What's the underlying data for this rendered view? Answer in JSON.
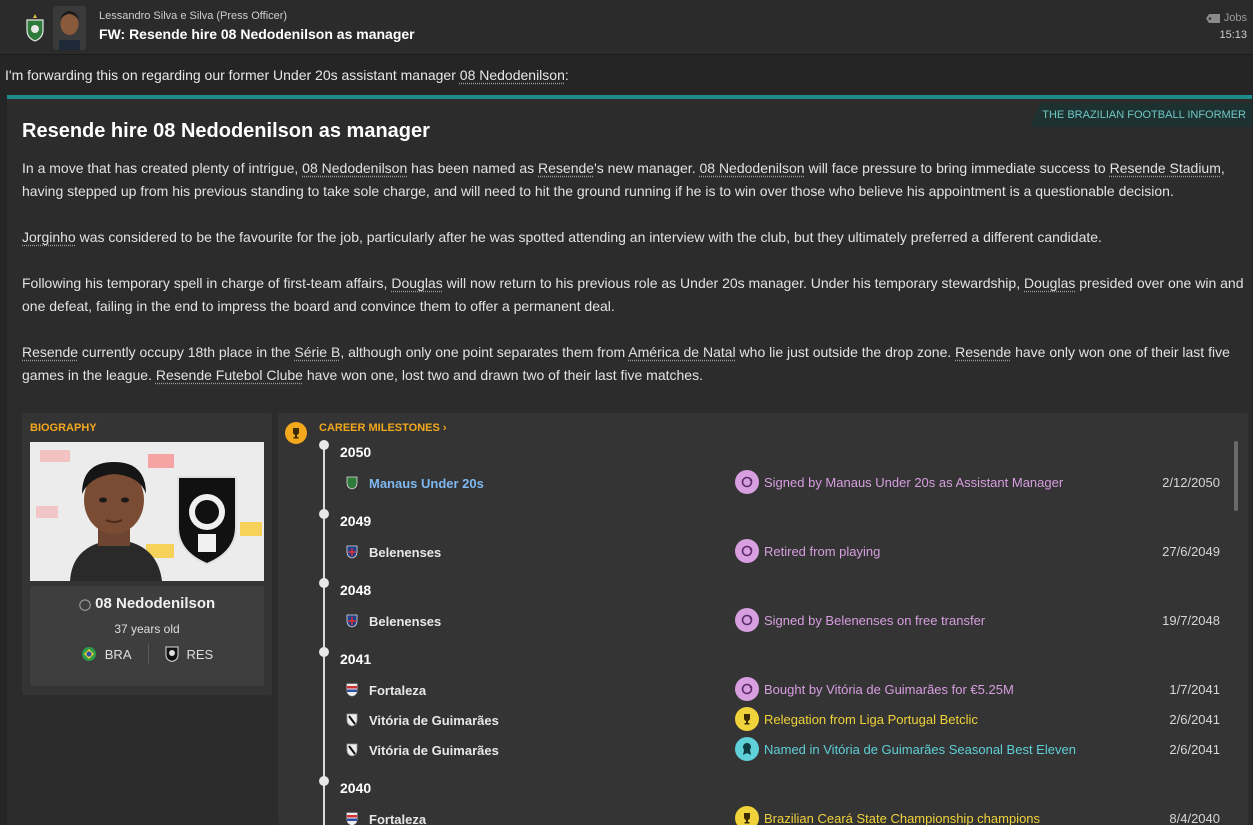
{
  "header": {
    "sender": "Lessandro Silva e Silva  (Press Officer)",
    "subject": "FW: Resende hire 08 Nedodenilson as manager",
    "tag": "Jobs",
    "time": "15:13"
  },
  "intro": {
    "text_before": "I'm forwarding this on regarding our former Under 20s assistant manager ",
    "person": "08 Nedodenilson",
    "text_after": ":"
  },
  "article": {
    "source": "THE BRAZILIAN FOOTBALL INFORMER",
    "title": "Resende hire 08 Nedodenilson as manager",
    "p1": [
      "In a move that has created plenty of intrigue, ",
      "08 Nedodenilson",
      " has been named as ",
      "Resende",
      "'s new manager. ",
      "08 Nedodenilson",
      " will face pressure to bring immediate success to ",
      "Resende Stadium",
      ", having stepped up from his previous standing to take sole charge, and will need to hit the ground running if he is to win over those who believe his appointment is a questionable decision."
    ],
    "p2": [
      "Jorginho",
      " was considered to be the favourite for the job, particularly after he was spotted attending an interview with the club, but they ultimately preferred a different candidate."
    ],
    "p3": [
      "Following his temporary spell in charge of first-team affairs, ",
      "Douglas",
      " will now return to his previous role as Under 20s manager. Under his temporary stewardship, ",
      "Douglas",
      " presided over one win and one defeat, failing in the end to impress the board and convince them to offer a permanent deal."
    ],
    "p4": [
      "Resende",
      " currently occupy 18th place in the ",
      "Série B",
      ", although only one point separates them from ",
      "América de Natal",
      " who lie just outside the drop zone. ",
      "Resende",
      " have only won one of their last five games in the league. ",
      "Resende Futebol Clube",
      " have won one, lost two and drawn two of their last five matches."
    ]
  },
  "biography": {
    "label": "BIOGRAPHY",
    "name": "08 Nedodenilson",
    "age": "37 years old",
    "nation": "BRA",
    "club": "RES"
  },
  "career": {
    "label": "CAREER MILESTONES",
    "chevron": "›",
    "years": [
      "2050",
      "2049",
      "2048",
      "2041",
      "2040"
    ],
    "entries": [
      {
        "club": "Manaus Under 20s",
        "event": "Signed by Manaus Under 20s as Assistant Manager",
        "date": "2/12/2050",
        "icon": "transfer-icon",
        "color": "#d79ee0"
      },
      {
        "club": "Belenenses",
        "event": "Retired from playing",
        "date": "27/6/2049",
        "icon": "transfer-icon",
        "color": "#d79ee0"
      },
      {
        "club": "Belenenses",
        "event": "Signed by Belenenses on free transfer",
        "date": "19/7/2048",
        "icon": "transfer-icon",
        "color": "#d79ee0"
      },
      {
        "club": "Fortaleza",
        "event": "Bought by Vitória de Guimarães for €5.25M",
        "date": "1/7/2041",
        "icon": "transfer-icon",
        "color": "#d79ee0"
      },
      {
        "club": "Vitória de Guimarães",
        "event": "Relegation from Liga Portugal Betclic",
        "date": "2/6/2041",
        "icon": "trophy-icon",
        "color": "#f0d23a"
      },
      {
        "club": "Vitória de Guimarães",
        "event": "Named in Vitória de Guimarães Seasonal Best Eleven",
        "date": "2/6/2041",
        "icon": "award-icon",
        "color": "#5fd0d8"
      },
      {
        "club": "Fortaleza",
        "event": "Brazilian Ceará State Championship champions",
        "date": "8/4/2040",
        "icon": "trophy-icon",
        "color": "#f0d23a"
      }
    ]
  }
}
